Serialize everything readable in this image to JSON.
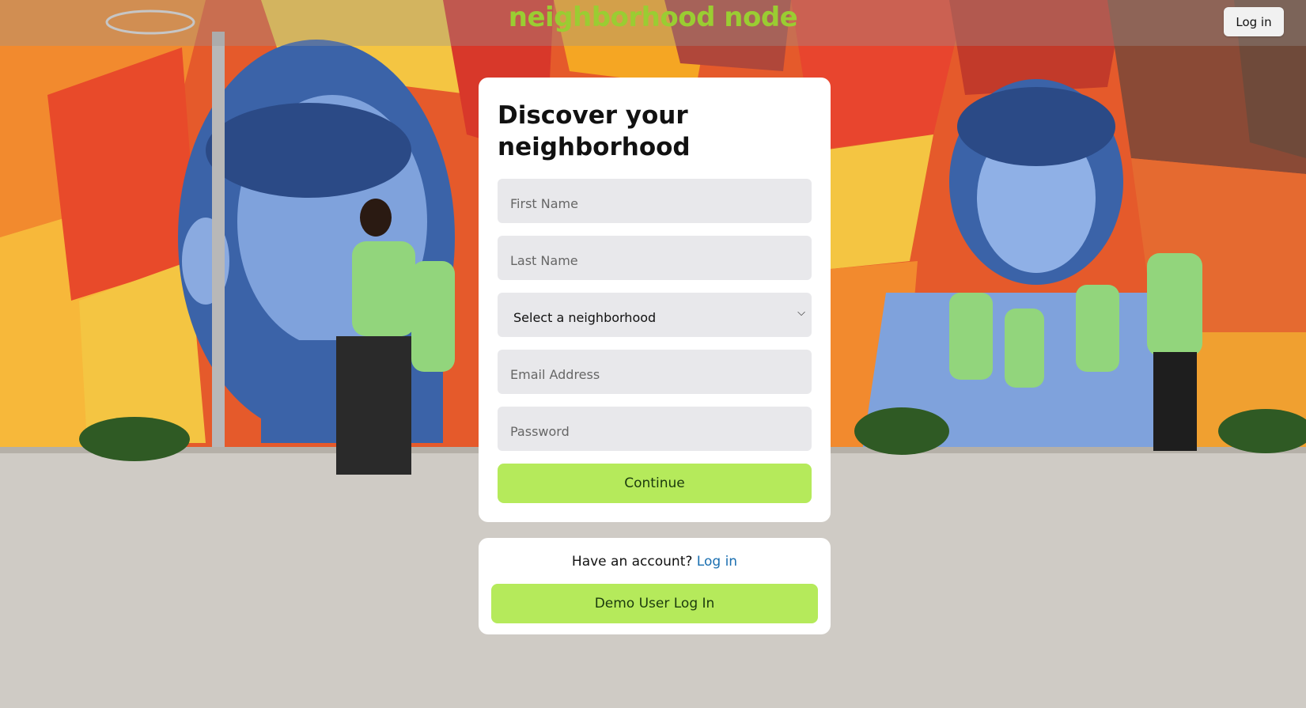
{
  "header": {
    "logo_text": "neighborhood node",
    "login_label": "Log in"
  },
  "signup": {
    "title": "Discover your neighborhood",
    "first_name_placeholder": "First Name",
    "last_name_placeholder": "Last Name",
    "neighborhood_selected": "Select a neighborhood",
    "email_placeholder": "Email Address",
    "password_placeholder": "Password",
    "continue_label": "Continue"
  },
  "login_box": {
    "prompt": "Have an account?",
    "login_link": "Log in",
    "demo_label": "Demo User Log In"
  },
  "colors": {
    "brand_green": "#9acd32",
    "button_green": "#b5ea5b",
    "link_blue": "#1a6fb0",
    "field_gray": "#e8e8eb"
  },
  "icons": {
    "select_caret": "chevron-down-icon"
  }
}
